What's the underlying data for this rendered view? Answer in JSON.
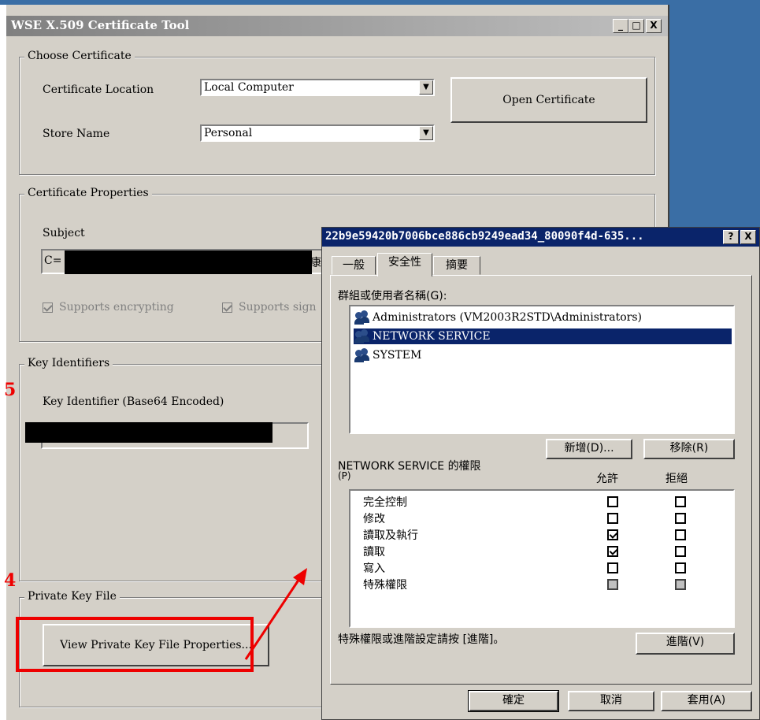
{
  "main_window": {
    "title": "WSE X.509 Certificate Tool",
    "caption_buttons": {
      "minimize": "_",
      "maximize": "□",
      "close": "X"
    },
    "choose_certificate": {
      "group_label": "Choose Certificate",
      "location_label": "Certificate Location",
      "location_value": "Local Computer",
      "store_label": "Store Name",
      "store_value": "Personal",
      "open_button": "Open Certificate"
    },
    "certificate_properties": {
      "group_label": "Certificate Properties",
      "subject_label": "Subject",
      "subject_prefix": "C=",
      "subject_suffix": "康",
      "supports_encrypting": "Supports encrypting",
      "supports_signing": "Supports sign"
    },
    "key_identifiers": {
      "group_label": "Key Identifiers",
      "key_label": "Key Identifier (Base64 Encoded)"
    },
    "private_key_file": {
      "group_label": "Private Key File",
      "view_button": "View Private Key File Properties..."
    }
  },
  "annotations": {
    "step_five": "5",
    "step_four": "4",
    "color": "#ee0000"
  },
  "dialog": {
    "title": "22b9e59420b7006bce886cb9249ead34_80090f4d-635...",
    "help_button": "?",
    "close_button": "X",
    "tabs": [
      "一般",
      "安全性",
      "摘要"
    ],
    "active_tab": "安全性",
    "groups_label": "群組或使用者名稱(G):",
    "users": [
      {
        "name": "Administrators (VM2003R2STD\\Administrators)",
        "selected": false
      },
      {
        "name": "NETWORK SERVICE",
        "selected": true
      },
      {
        "name": "SYSTEM",
        "selected": false
      }
    ],
    "add_button": "新增(D)...",
    "remove_button": "移除(R)",
    "permissions_label_line1": "NETWORK SERVICE 的權限",
    "permissions_label_line2": "(P)",
    "allow_header": "允許",
    "deny_header": "拒絕",
    "permissions": [
      {
        "name": "完全控制",
        "allow": false,
        "deny": false,
        "grey": false
      },
      {
        "name": "修改",
        "allow": false,
        "deny": false,
        "grey": false
      },
      {
        "name": "讀取及執行",
        "allow": true,
        "deny": false,
        "grey": false
      },
      {
        "name": "讀取",
        "allow": true,
        "deny": false,
        "grey": false
      },
      {
        "name": "寫入",
        "allow": false,
        "deny": false,
        "grey": false
      },
      {
        "name": "特殊權限",
        "allow": false,
        "deny": false,
        "grey": true
      }
    ],
    "advanced_note": "特殊權限或進階設定請按 [進階]。",
    "advanced_button": "進階(V)",
    "ok_button": "確定",
    "cancel_button": "取消",
    "apply_button": "套用(A)"
  }
}
